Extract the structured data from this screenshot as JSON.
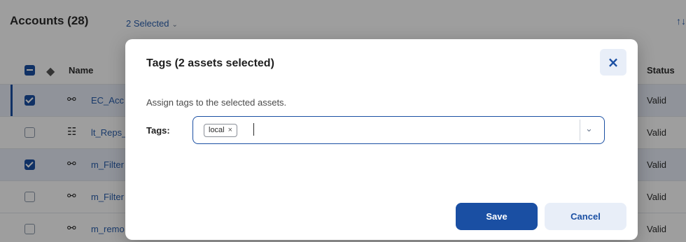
{
  "header": {
    "title": "Accounts (28)",
    "selected_label": "2 Selected",
    "selected_chevron": "⌄",
    "sort_icon": "↑↓"
  },
  "table": {
    "columns": {
      "name": "Name",
      "status": "Status"
    },
    "rows": [
      {
        "name": "EC_Acc",
        "status": "Valid",
        "checked": true,
        "icon": "mapping-icon"
      },
      {
        "name": "lt_Reps_",
        "status": "Valid",
        "checked": false,
        "icon": "taskflow-icon"
      },
      {
        "name": "m_Filter",
        "status": "Valid",
        "checked": true,
        "icon": "mapping-icon"
      },
      {
        "name": "m_Filter",
        "status": "Valid",
        "checked": false,
        "icon": "mapping-icon"
      },
      {
        "name": "m_remo",
        "status": "Valid",
        "checked": false,
        "icon": "mapping-icon"
      }
    ]
  },
  "modal": {
    "title": "Tags (2 assets selected)",
    "close_label": "×",
    "description": "Assign tags to the selected assets.",
    "tags_label": "Tags:",
    "chips": [
      {
        "label": "local",
        "remove": "×"
      }
    ],
    "input_value": "",
    "dropdown_chevron": "⌄",
    "save_label": "Save",
    "cancel_label": "Cancel"
  },
  "colors": {
    "accent": "#1a4fa3",
    "accent_light": "#e8eef8",
    "link": "#2b5fad"
  }
}
